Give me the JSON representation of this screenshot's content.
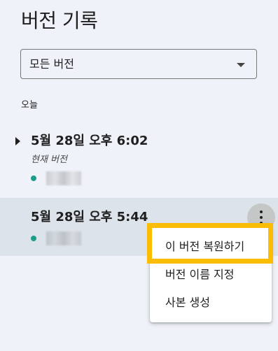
{
  "panel": {
    "title": "버전 기록"
  },
  "filter": {
    "selected": "모든 버전"
  },
  "section": {
    "label": "오늘"
  },
  "versions": [
    {
      "date": "5월 28일 오후 6:02",
      "current_label": "현재 버전"
    },
    {
      "date": "5월 28일 오후 5:44"
    }
  ],
  "menu": {
    "restore": "이 버전 복원하기",
    "rename": "버전 이름 지정",
    "copy": "사본 생성"
  },
  "colors": {
    "author_dot": "#1e9e8a",
    "highlight": "#fbbc04",
    "selected_row": "#dde3ea"
  }
}
